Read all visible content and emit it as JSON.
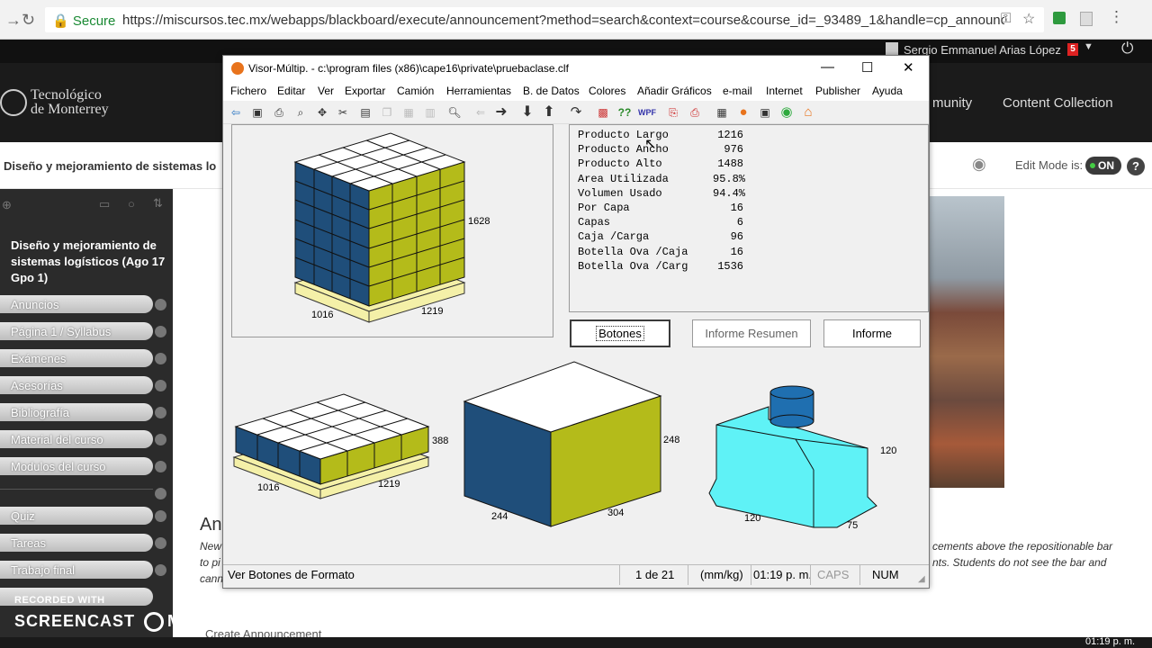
{
  "browser": {
    "secure_label": "Secure",
    "url": "https://miscursos.tec.mx/webapps/blackboard/execute/announcement?method=search&context=course&course_id=_93489_1&handle=cp_announcemen..."
  },
  "bb": {
    "logo_line1": "Tecnológico",
    "logo_line2": "de Monterrey",
    "user_name": "Sergio Emmanuel Arias López",
    "notif_count": "5",
    "nav_community": "munity",
    "nav_content_collection": "Content Collection",
    "course_title_bar": "Diseño y mejoramiento de sistemas lo",
    "edit_mode_label": "Edit Mode is:",
    "edit_mode_value": "ON",
    "help_label": "?",
    "sidebar_title": "Diseño y mejoramiento de sistemas logísticos (Ago 17 Gpo 1)",
    "sidebar_items": [
      "Anuncios",
      "Página 1 / Syllabus",
      "Exámenes",
      "Asesorías",
      "Bibliografía",
      "Material del curso",
      "Modulos del curso",
      "Quiz",
      "Tareas",
      "Trabajo final"
    ],
    "page_heading": "An",
    "note_left_1": "New",
    "note_left_2": "to pi",
    "note_left_3": "cann",
    "note_right_1": "cements above the repositionable bar",
    "note_right_2": "nts. Students do not see the bar and",
    "create_announcement": "Create Announcement"
  },
  "window": {
    "title": "Visor-Múltip. - c:\\program files (x86)\\cape16\\private\\pruebaclase.clf",
    "menu": [
      "Fichero",
      "Editar",
      "Ver",
      "Exportar",
      "Camión",
      "Herramientas",
      "B. de Datos",
      "Colores",
      "Añadir Gráficos",
      "e-mail",
      "Internet",
      "Publisher",
      "Ayuda"
    ],
    "stats": [
      {
        "label": "Producto Largo",
        "value": "1216"
      },
      {
        "label": "Producto Ancho",
        "value": "976"
      },
      {
        "label": "Producto Alto",
        "value": "1488"
      },
      {
        "label": "Area Utilizada",
        "value": "95.8%"
      },
      {
        "label": "Volumen Usado",
        "value": "94.4%"
      },
      {
        "label": "Por Capa",
        "value": "16"
      },
      {
        "label": "Capas",
        "value": "6"
      },
      {
        "label": "Caja /Carga",
        "value": "96"
      },
      {
        "label": "Botella Ova /Caja",
        "value": "16"
      },
      {
        "label": "Botella Ova /Carg",
        "value": "1536"
      }
    ],
    "buttons": {
      "botones": "Botones",
      "informe_resumen": "Informe Resumen",
      "informe": "Informe"
    },
    "dims": {
      "pallet_height": "1628",
      "pallet_width": "1016",
      "pallet_depth": "1219",
      "layer_height": "388",
      "layer_width": "1016",
      "layer_depth": "1219",
      "case_height": "248",
      "case_width": "244",
      "case_depth": "304",
      "bottle_height": "120",
      "bottle_width": "120",
      "bottle_depth": "75"
    },
    "status": {
      "hint": "Ver Botones de Formato",
      "page": "1 de 21",
      "units": "(mm/kg)",
      "time": "01:19 p. m.",
      "caps": "CAPS",
      "num": "NUM"
    }
  },
  "screencast": {
    "line1": "RECORDED WITH",
    "line2": "SCREENCAST",
    "line3": "MATIC"
  },
  "taskbar": {
    "clock": "01:19 p. m."
  },
  "colors": {
    "blue": "#1f4e7a",
    "olive": "#b4bb1a",
    "cyan": "#5ff2f6",
    "pallet": "#f4f0a8"
  }
}
